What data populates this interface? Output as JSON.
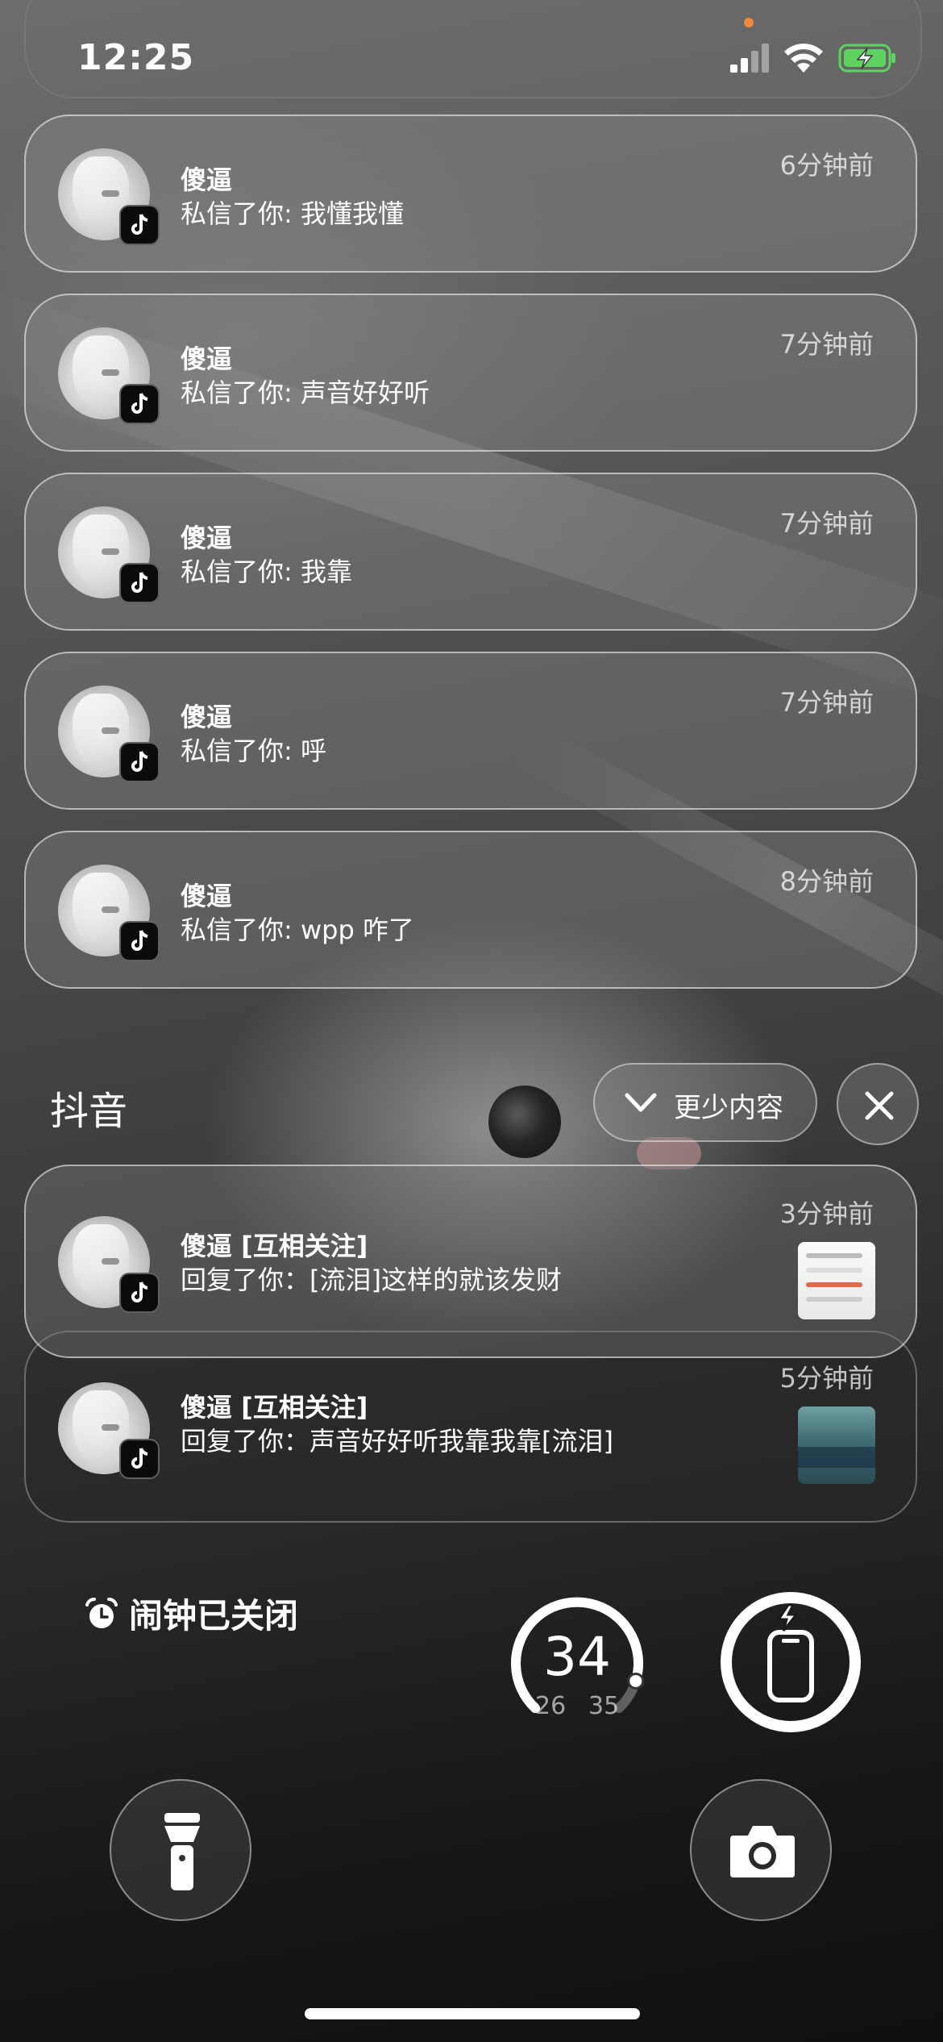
{
  "status_bar": {
    "time": "12:25",
    "icons": [
      "cellular-signal-icon",
      "wifi-icon",
      "battery-charging-icon"
    ],
    "privacy_indicator_color": "#f08a3a"
  },
  "notifications": [
    {
      "title": "傻逼",
      "body": "私信了你: 我懂我懂",
      "time": "6分钟前",
      "app_icon": "tiktok-icon"
    },
    {
      "title": "傻逼",
      "body": "私信了你: 声音好好听",
      "time": "7分钟前",
      "app_icon": "tiktok-icon"
    },
    {
      "title": "傻逼",
      "body": "私信了你: 我靠",
      "time": "7分钟前",
      "app_icon": "tiktok-icon"
    },
    {
      "title": "傻逼",
      "body": "私信了你: 呼",
      "time": "7分钟前",
      "app_icon": "tiktok-icon"
    },
    {
      "title": "傻逼",
      "body": "私信了你: wpp 咋了",
      "time": "8分钟前",
      "app_icon": "tiktok-icon"
    }
  ],
  "group": {
    "title": "抖音",
    "show_less_label": "更少内容",
    "close_icon": "close-icon",
    "notifications": [
      {
        "title": "傻逼 [互相关注]",
        "body": "回复了你：[流泪]这样的就该发财",
        "time": "3分钟前",
        "app_icon": "tiktok-icon"
      },
      {
        "title": "傻逼 [互相关注]",
        "body": "回复了你：声音好好听我靠我靠[流泪]",
        "time": "5分钟前",
        "app_icon": "tiktok-icon"
      }
    ]
  },
  "widgets": {
    "alarm_label": "闹钟已关闭",
    "temperature": {
      "current": "34",
      "low": "26",
      "high": "35",
      "fraction": 0.89
    },
    "battery_ring_icon": "phone-charging-icon"
  },
  "quick_actions": {
    "flashlight_icon": "flashlight-icon",
    "camera_icon": "camera-icon"
  }
}
